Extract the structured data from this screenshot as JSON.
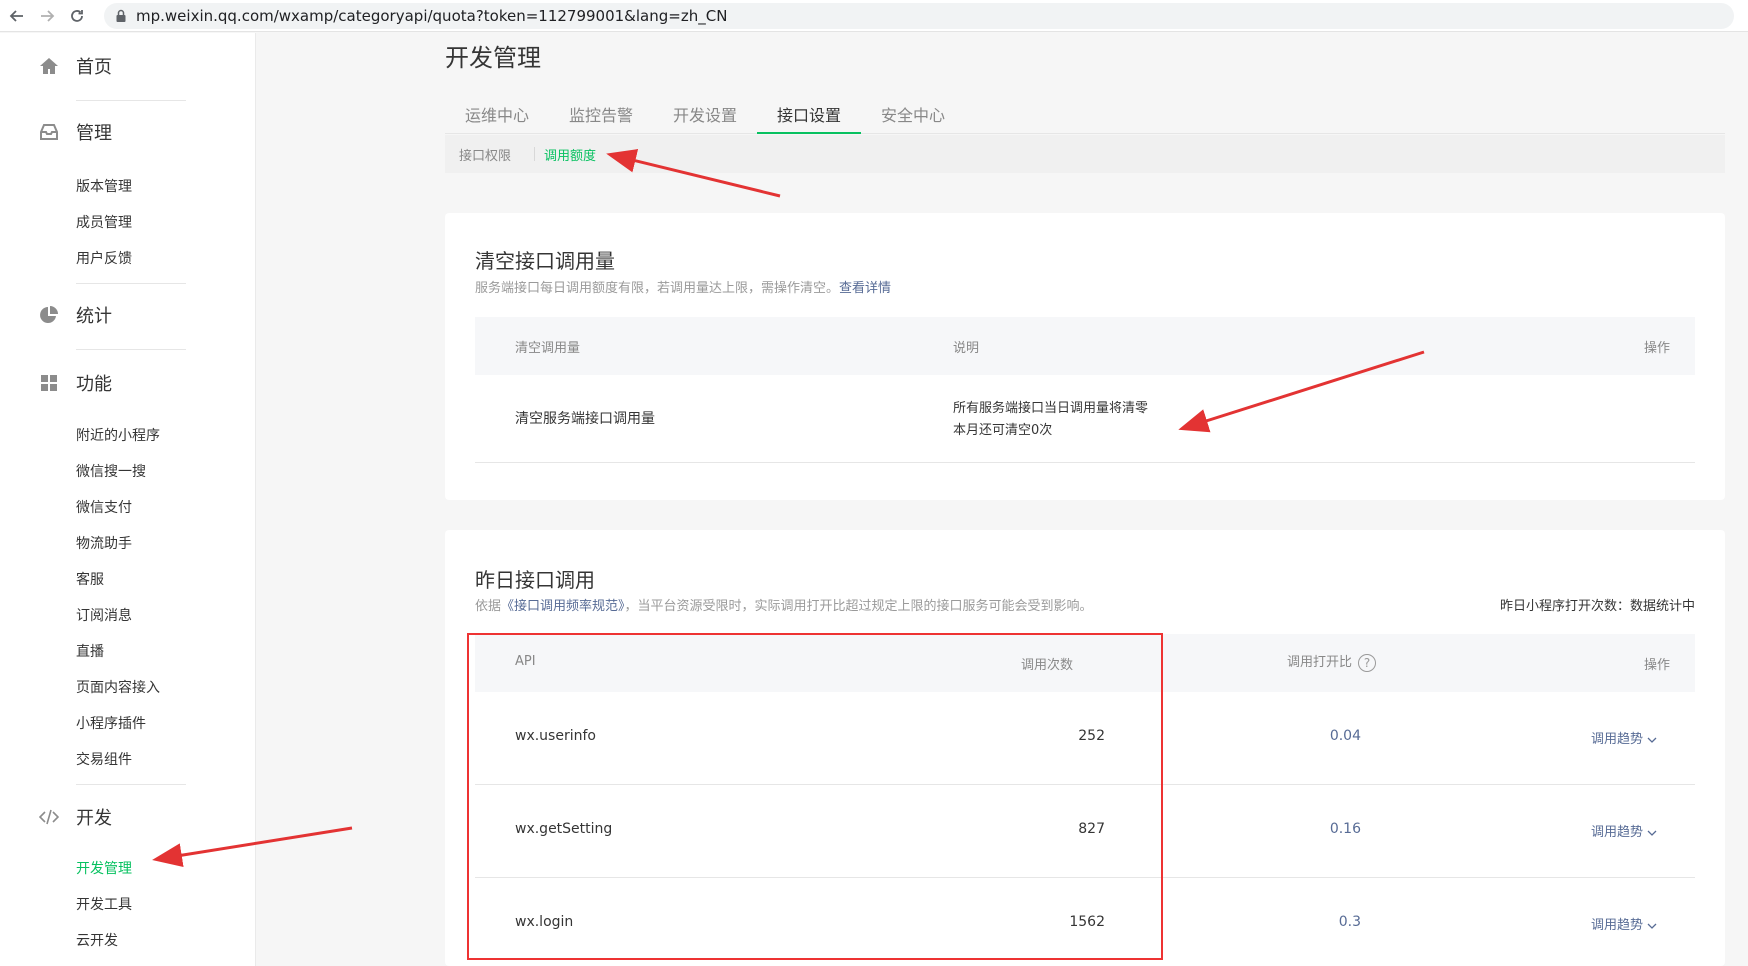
{
  "browser": {
    "url": "mp.weixin.qq.com/wxamp/categoryapi/quota?token=112799001&lang=zh_CN"
  },
  "sidebar": {
    "home": "首页",
    "manage": "管理",
    "manage_items": [
      "版本管理",
      "成员管理",
      "用户反馈"
    ],
    "stats": "统计",
    "features": "功能",
    "feature_items": [
      "附近的小程序",
      "微信搜一搜",
      "微信支付",
      "物流助手",
      "客服",
      "订阅消息",
      "直播",
      "页面内容接入",
      "小程序插件",
      "交易组件"
    ],
    "dev": "开发",
    "dev_items": [
      "开发管理",
      "开发工具",
      "云开发"
    ]
  },
  "main": {
    "title": "开发管理",
    "tabs": [
      "运维中心",
      "监控告警",
      "开发设置",
      "接口设置",
      "安全中心"
    ],
    "subtabs": [
      "接口权限",
      "调用额度"
    ]
  },
  "clear_card": {
    "title": "清空接口调用量",
    "desc": "服务端接口每日调用额度有限，若调用量达上限，需操作清空。",
    "desc_link": "查看详情",
    "headers": [
      "清空调用量",
      "说明",
      "操作"
    ],
    "row_name": "清空服务端接口调用量",
    "row_desc1": "所有服务端接口当日调用量将清零",
    "row_desc2": "本月还可清空0次"
  },
  "yesterday_card": {
    "title": "昨日接口调用",
    "desc_prefix": "依据",
    "desc_link": "《接口调用频率规范》",
    "desc_suffix": "，当平台资源受限时，实际调用打开比超过规定上限的接口服务可能会受到影响。",
    "right_note": "昨日小程序打开次数：数据统计中",
    "headers": [
      "API",
      "调用次数",
      "调用打开比",
      "操作"
    ],
    "help_icon": "?",
    "rows": [
      {
        "api": "wx.userinfo",
        "count": "252",
        "ratio": "0.04",
        "action": "调用趋势"
      },
      {
        "api": "wx.getSetting",
        "count": "827",
        "ratio": "0.16",
        "action": "调用趋势"
      },
      {
        "api": "wx.login",
        "count": "1562",
        "ratio": "0.3",
        "action": "调用趋势"
      }
    ]
  },
  "colors": {
    "accent": "#07c160",
    "link": "#576b95",
    "annotation_red": "#e33333"
  }
}
